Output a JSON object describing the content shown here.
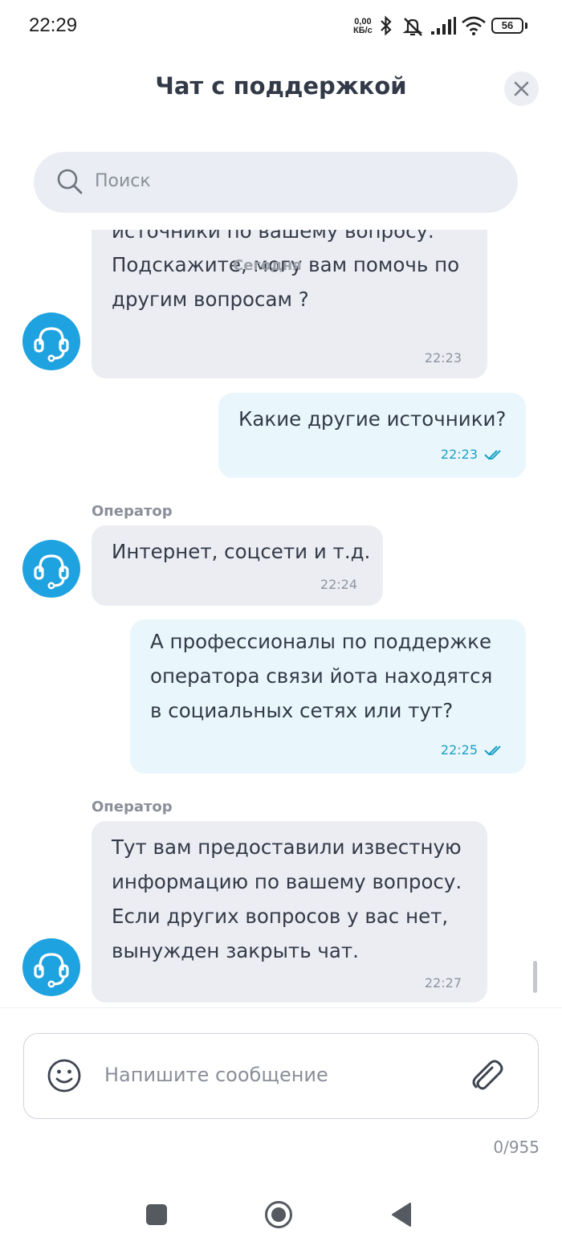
{
  "status_bar": {
    "time": "22:29",
    "net_speed_value": "0,00",
    "net_speed_unit": "КБ/с",
    "battery": "56"
  },
  "header": {
    "title": "Чат с поддержкой"
  },
  "search": {
    "placeholder": "Поиск"
  },
  "date_chip": "Сегодня",
  "messages": [
    {
      "from": "operator",
      "lines": [
        "источники по вашему вопросу.",
        "Подскажите, могу вам помочь по",
        "другим вопросам ?"
      ],
      "time": "22:23"
    },
    {
      "from": "me",
      "lines": [
        "Какие другие источники?"
      ],
      "time": "22:23"
    },
    {
      "from": "operator",
      "label": "Оператор",
      "lines": [
        "Интернет, соцсети и т.д."
      ],
      "time": "22:24"
    },
    {
      "from": "me",
      "lines": [
        "А профессионалы по поддержке",
        "оператора связи йота находятся",
        "в социальных сетях или тут?"
      ],
      "time": "22:25"
    },
    {
      "from": "operator",
      "label": "Оператор",
      "lines": [
        "Тут вам предоставили известную",
        "информацию по вашему вопросу.",
        "Если других вопросов у вас нет,",
        "вынужден закрыть чат."
      ],
      "time": "22:27"
    }
  ],
  "composer": {
    "placeholder": "Напишите сообщение",
    "char_count": "0/955"
  },
  "icons": {
    "search": "search-icon",
    "close": "close-icon",
    "avatar": "headset-icon",
    "read": "double-check-icon",
    "emoji": "smile-icon",
    "attach": "paperclip-icon"
  },
  "colors": {
    "accent": "#1ea3e0",
    "operator_bubble": "#ebedf3",
    "user_bubble": "#e9f7fd",
    "read_time": "#1aa0c6"
  }
}
